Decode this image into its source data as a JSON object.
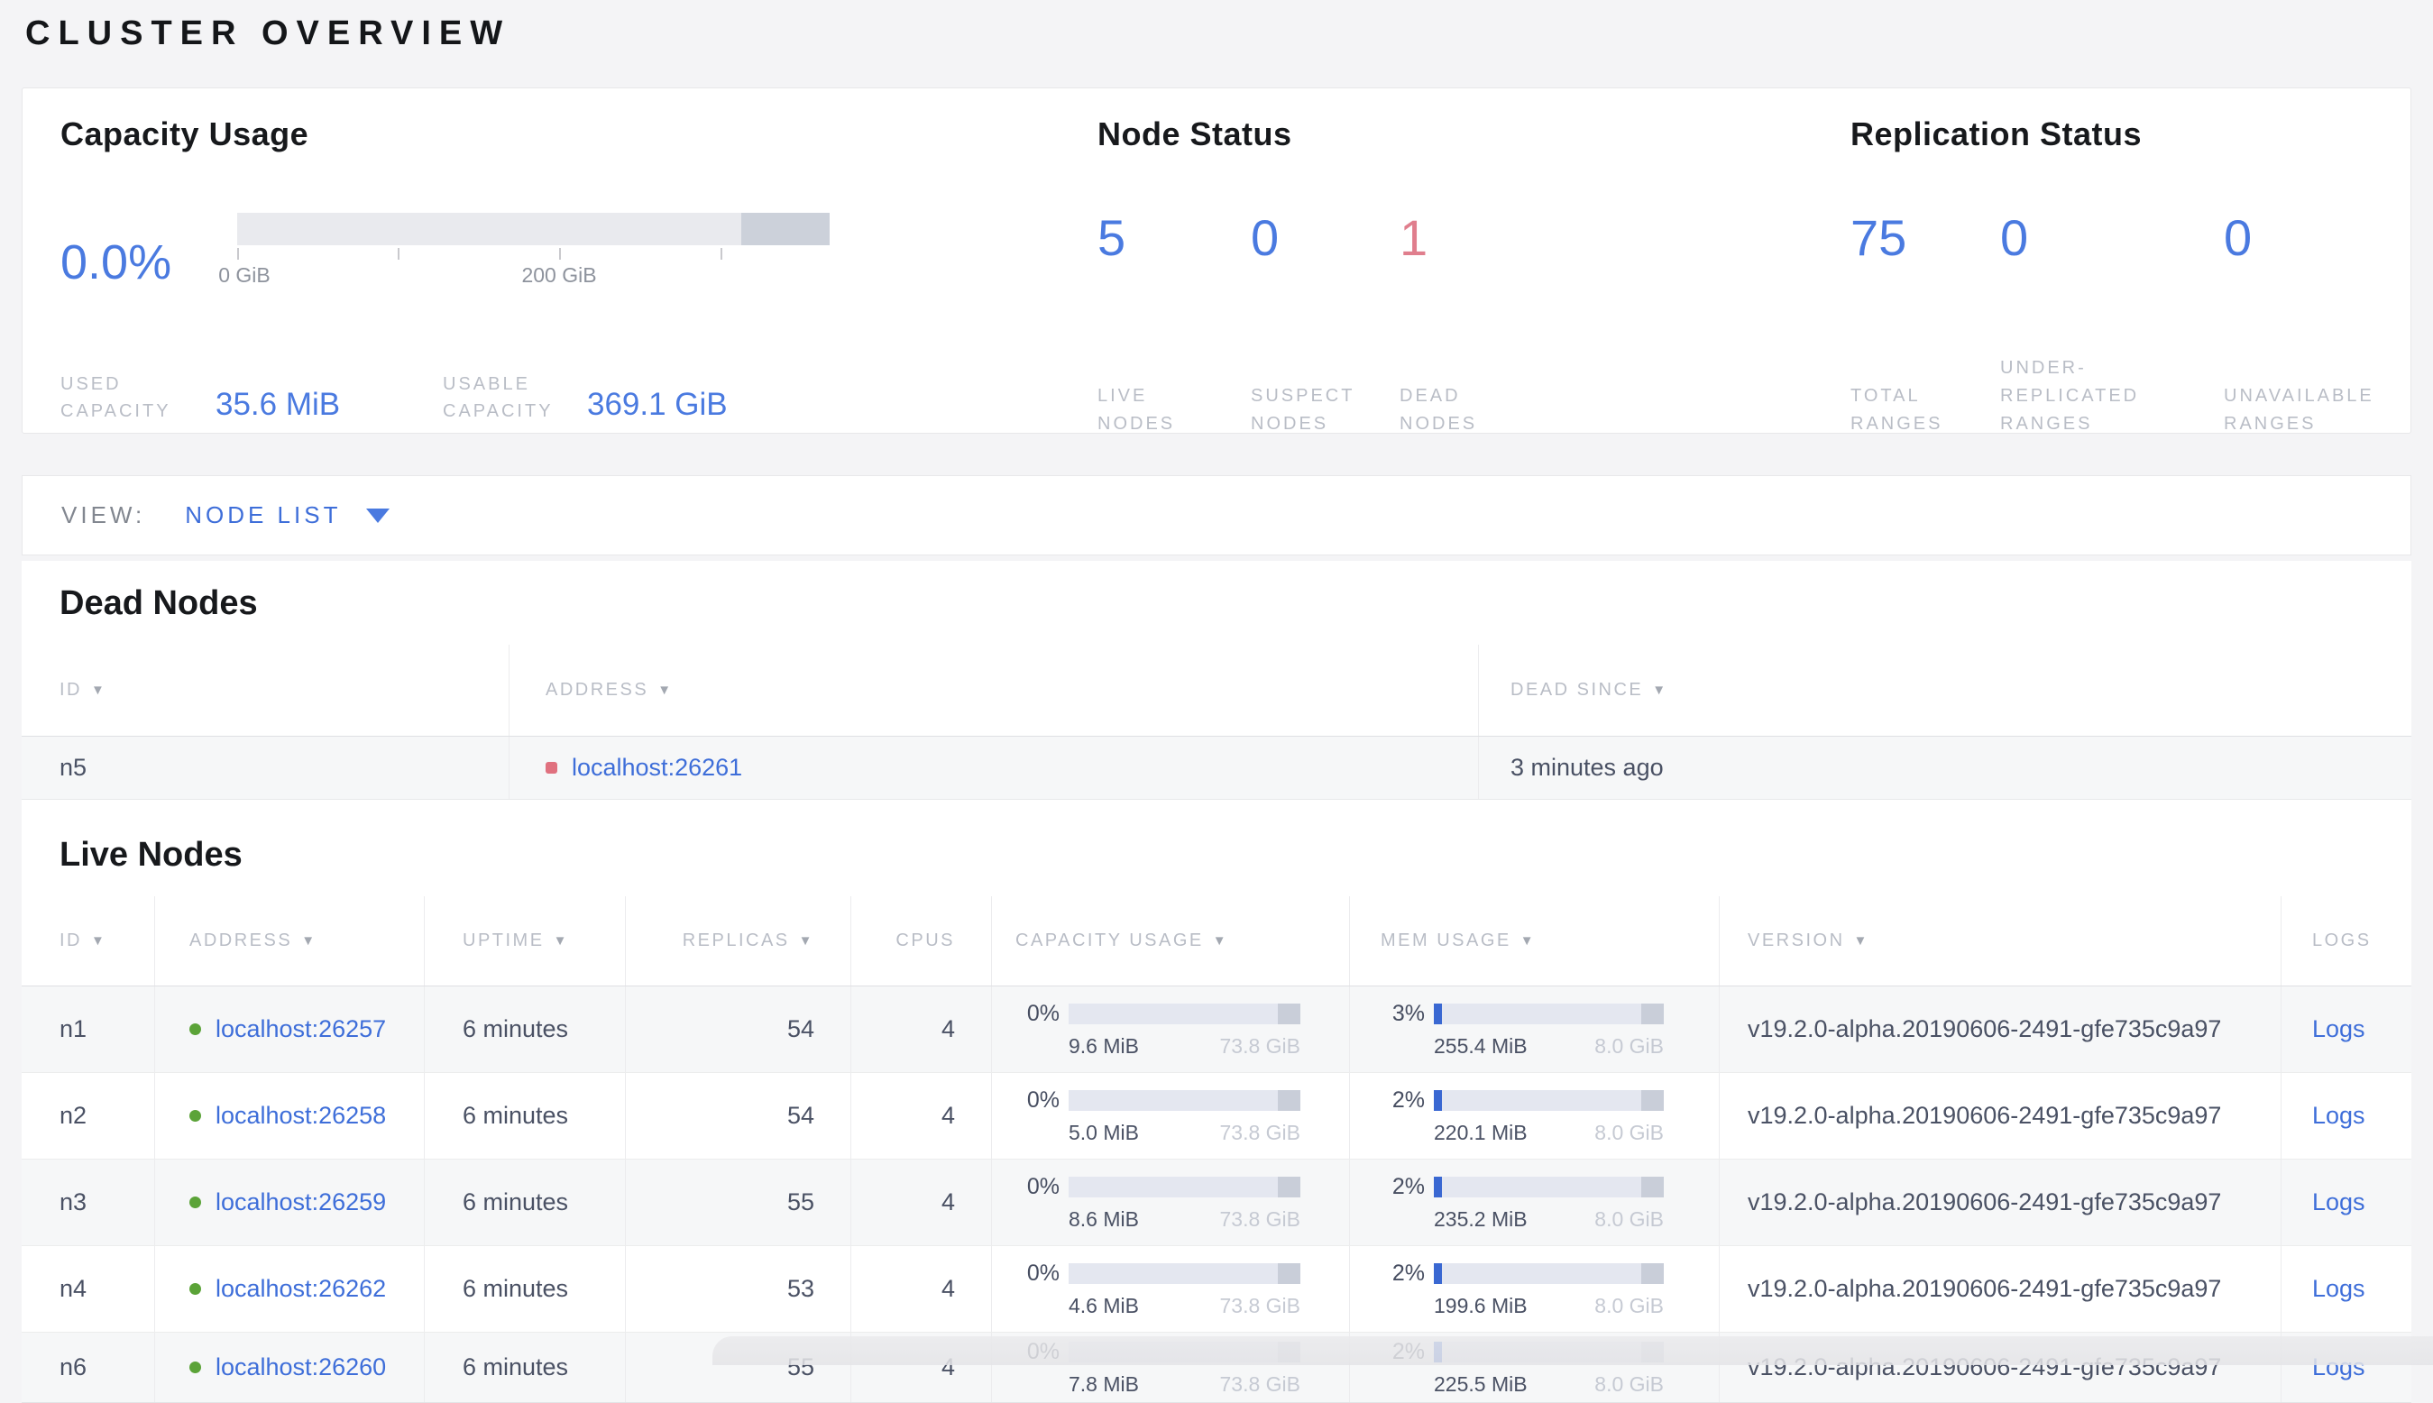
{
  "colors": {
    "accent_blue": "#4a7ae0",
    "link_blue": "#3e6ed9",
    "alert_red": "#e07e8d",
    "live_dot_green": "#5ba338",
    "dead_dot_red": "#e0717f"
  },
  "page": {
    "title": "CLUSTER OVERVIEW"
  },
  "summary": {
    "capacity": {
      "title": "Capacity Usage",
      "percent": "0.0%",
      "axis_labels": [
        "0 GiB",
        "200 GiB"
      ],
      "used_label": "USED CAPACITY",
      "used_value": "35.6 MiB",
      "usable_label": "USABLE CAPACITY",
      "usable_value": "369.1 GiB"
    },
    "node_status": {
      "title": "Node Status",
      "metrics": [
        {
          "value": "5",
          "label": "LIVE NODES"
        },
        {
          "value": "0",
          "label": "SUSPECT NODES"
        },
        {
          "value": "1",
          "label": "DEAD NODES"
        }
      ]
    },
    "replication": {
      "title": "Replication Status",
      "metrics": [
        {
          "value": "75",
          "label": "TOTAL RANGES"
        },
        {
          "value": "0",
          "label": "UNDER-REPLICATED RANGES"
        },
        {
          "value": "0",
          "label": "UNAVAILABLE RANGES"
        }
      ]
    }
  },
  "view_bar": {
    "label": "VIEW:",
    "selected": "NODE LIST"
  },
  "dead_nodes": {
    "title": "Dead Nodes",
    "columns": {
      "id": "ID",
      "address": "ADDRESS",
      "dead_since": "DEAD SINCE"
    },
    "rows": [
      {
        "id": "n5",
        "address": "localhost:26261",
        "dead_since": "3 minutes ago"
      }
    ]
  },
  "live_nodes": {
    "title": "Live Nodes",
    "columns": {
      "id": "ID",
      "address": "ADDRESS",
      "uptime": "UPTIME",
      "replicas": "REPLICAS",
      "cpus": "CPUS",
      "capacity": "CAPACITY USAGE",
      "mem": "MEM USAGE",
      "version": "VERSION",
      "logs": "LOGS"
    },
    "rows": [
      {
        "id": "n1",
        "address": "localhost:26257",
        "uptime": "6 minutes",
        "replicas": "54",
        "cpus": "4",
        "cap_pct_label": "0%",
        "cap_pct": 0,
        "cap_used": "9.6 MiB",
        "cap_total": "73.8 GiB",
        "mem_pct_label": "3%",
        "mem_pct": 3,
        "mem_used": "255.4 MiB",
        "mem_total": "8.0 GiB",
        "version": "v19.2.0-alpha.20190606-2491-gfe735c9a97",
        "logs_label": "Logs"
      },
      {
        "id": "n2",
        "address": "localhost:26258",
        "uptime": "6 minutes",
        "replicas": "54",
        "cpus": "4",
        "cap_pct_label": "0%",
        "cap_pct": 0,
        "cap_used": "5.0 MiB",
        "cap_total": "73.8 GiB",
        "mem_pct_label": "2%",
        "mem_pct": 2,
        "mem_used": "220.1 MiB",
        "mem_total": "8.0 GiB",
        "version": "v19.2.0-alpha.20190606-2491-gfe735c9a97",
        "logs_label": "Logs"
      },
      {
        "id": "n3",
        "address": "localhost:26259",
        "uptime": "6 minutes",
        "replicas": "55",
        "cpus": "4",
        "cap_pct_label": "0%",
        "cap_pct": 0,
        "cap_used": "8.6 MiB",
        "cap_total": "73.8 GiB",
        "mem_pct_label": "2%",
        "mem_pct": 2,
        "mem_used": "235.2 MiB",
        "mem_total": "8.0 GiB",
        "version": "v19.2.0-alpha.20190606-2491-gfe735c9a97",
        "logs_label": "Logs"
      },
      {
        "id": "n4",
        "address": "localhost:26262",
        "uptime": "6 minutes",
        "replicas": "53",
        "cpus": "4",
        "cap_pct_label": "0%",
        "cap_pct": 0,
        "cap_used": "4.6 MiB",
        "cap_total": "73.8 GiB",
        "mem_pct_label": "2%",
        "mem_pct": 2,
        "mem_used": "199.6 MiB",
        "mem_total": "8.0 GiB",
        "version": "v19.2.0-alpha.20190606-2491-gfe735c9a97",
        "logs_label": "Logs"
      },
      {
        "id": "n6",
        "address": "localhost:26260",
        "uptime": "6 minutes",
        "replicas": "55",
        "cpus": "4",
        "cap_pct_label": "0%",
        "cap_pct": 0,
        "cap_used": "7.8 MiB",
        "cap_total": "73.8 GiB",
        "mem_pct_label": "2%",
        "mem_pct": 2,
        "mem_used": "225.5 MiB",
        "mem_total": "8.0 GiB",
        "version": "v19.2.0-alpha.20190606-2491-gfe735c9a97",
        "logs_label": "Logs"
      }
    ]
  }
}
